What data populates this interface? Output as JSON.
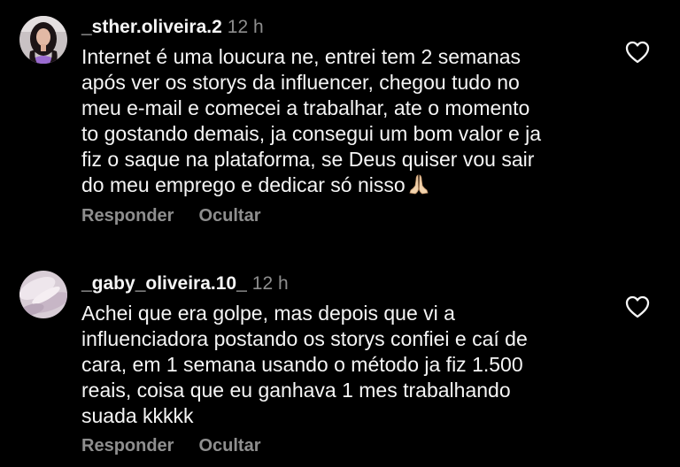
{
  "comments": [
    {
      "username": "_sther.oliveira.2",
      "time": "12 h",
      "lines": [
        "Internet é uma loucura ne, entrei tem 2 semanas",
        "após ver os storys da influencer, chegou tudo no",
        "meu e-mail e comecei a trabalhar, ate o momento",
        "to gostando demais, ja consegui um bom valor e ja",
        "fiz o saque na plataforma, se Deus quiser vou sair",
        "do meu emprego e dedicar só nisso"
      ],
      "emoji": "praying-hands-icon",
      "reply_label": "Responder",
      "hide_label": "Ocultar"
    },
    {
      "username": "_gaby_oliveira.10_",
      "time": "12 h",
      "lines": [
        "Achei que era golpe, mas depois que vi a",
        "influenciadora postando os storys confiei e caí de",
        "cara, em 1 semana usando o método ja fiz 1.500",
        "reais, coisa que eu ganhava 1 mes trabalhando",
        "suada kkkkk"
      ],
      "reply_label": "Responder",
      "hide_label": "Ocultar"
    }
  ],
  "colors": {
    "background": "#000000",
    "text": "#f5f5f5",
    "muted": "#8e8e8e"
  },
  "icons": [
    "heart-outline-icon",
    "praying-hands-icon",
    "avatar"
  ]
}
